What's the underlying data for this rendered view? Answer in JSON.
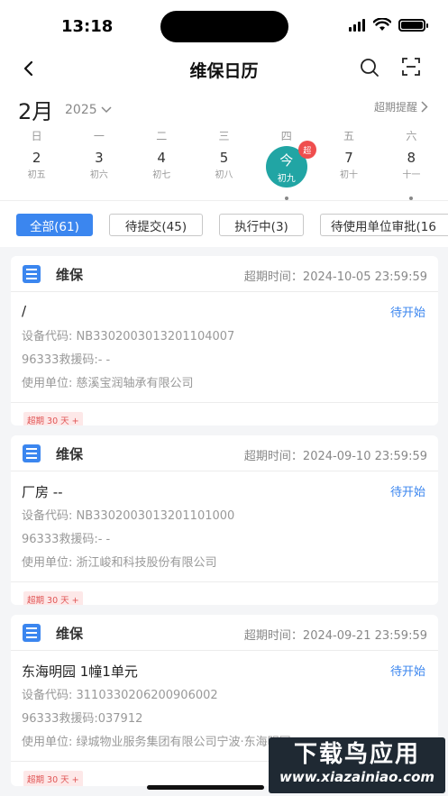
{
  "status_bar": {
    "time": "13:18"
  },
  "header": {
    "title": "维保日历"
  },
  "calendar": {
    "month": "2月",
    "year": "2025",
    "overdue_reminder": "超期提醒",
    "weekdays": [
      "日",
      "一",
      "二",
      "三",
      "四",
      "五",
      "六"
    ],
    "days": [
      {
        "num": "2",
        "lunar": "初五",
        "dot": false
      },
      {
        "num": "3",
        "lunar": "初六",
        "dot": false
      },
      {
        "num": "4",
        "lunar": "初七",
        "dot": false
      },
      {
        "num": "5",
        "lunar": "初八",
        "dot": false
      },
      {
        "num": "今",
        "lunar": "初九",
        "dot": true,
        "today": true,
        "badge": "超"
      },
      {
        "num": "7",
        "lunar": "初十",
        "dot": false
      },
      {
        "num": "8",
        "lunar": "十一",
        "dot": true
      }
    ]
  },
  "filters": [
    {
      "label": "全部(61)",
      "active": true
    },
    {
      "label": "待提交(45)",
      "active": false
    },
    {
      "label": "执行中(3)",
      "active": false
    },
    {
      "label": "待使用单位审批(16",
      "active": false
    }
  ],
  "cards": [
    {
      "type": "维保",
      "deadline": "超期时间：2024-10-05 23:59:59",
      "location": "/",
      "status": "待开始",
      "device_code": "设备代码: NB3302003013201104007",
      "rescue_code": "96333救援码:- -",
      "unit": "使用单位: 慈溪宝润轴承有限公司",
      "overdue_tag": "超期 30 天 +"
    },
    {
      "type": "维保",
      "deadline": "超期时间：2024-09-10 23:59:59",
      "location": "厂房  --",
      "status": "待开始",
      "device_code": "设备代码: NB3302003013201101000",
      "rescue_code": "96333救援码:- -",
      "unit": "使用单位: 浙江峻和科技股份有限公司",
      "overdue_tag": "超期 30 天 +"
    },
    {
      "type": "维保",
      "deadline": "超期时间：2024-09-21 23:59:59",
      "location": "东海明园  1幢1单元",
      "status": "待开始",
      "device_code": "设备代码: 3110330206200906002",
      "rescue_code": "96333救援码:037912",
      "unit": "使用单位: 绿城物业服务集团有限公司宁波·东海明园",
      "overdue_tag": "超期 30 天 +"
    }
  ],
  "watermark": {
    "title": "下载鸟应用",
    "url": "www.xiazainiao.com"
  }
}
